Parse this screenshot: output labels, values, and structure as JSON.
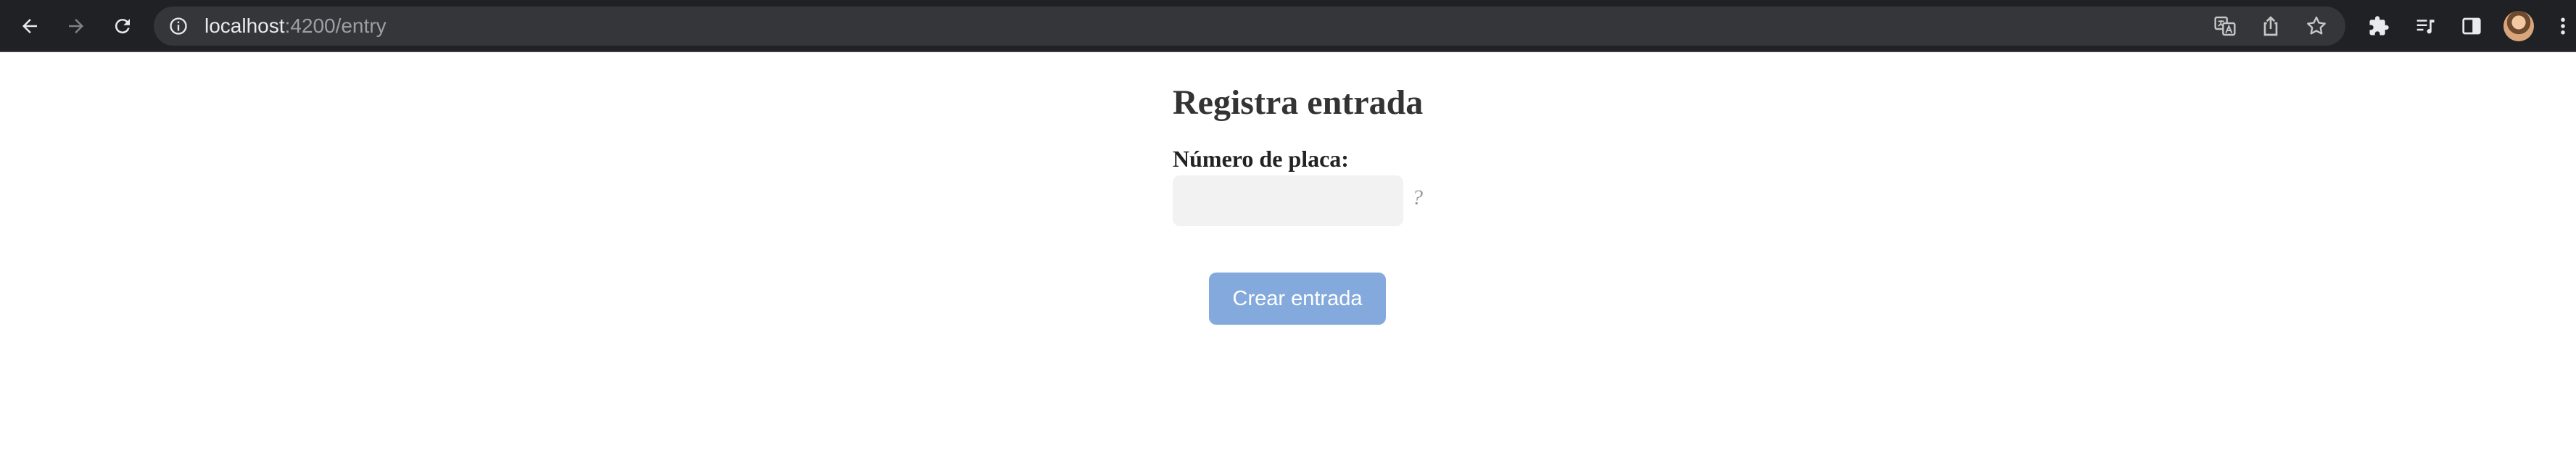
{
  "browser": {
    "url_host": "localhost",
    "url_path": ":4200/entry",
    "icons": {
      "back": "arrow-left-icon",
      "forward": "arrow-right-icon",
      "reload": "reload-icon",
      "site_info": "info-icon",
      "translate": "translate-icon",
      "share": "share-icon",
      "bookmark": "star-icon",
      "extensions": "puzzle-icon",
      "reading_list": "reading-list-icon",
      "side_panel": "side-panel-icon",
      "menu": "kebab-menu-icon"
    },
    "colors": {
      "toolbar": "#202124",
      "omnibox": "#35363a",
      "text": "#e8eaed",
      "muted": "#9aa0a6"
    }
  },
  "page": {
    "title": "Registra entrada",
    "plate_label": "Número de placa:",
    "plate_value": "",
    "hint": "?",
    "submit_label": "Crear entrada",
    "colors": {
      "button": "#84a9dc",
      "input": "#f2f2f2",
      "heading": "#333333"
    }
  }
}
